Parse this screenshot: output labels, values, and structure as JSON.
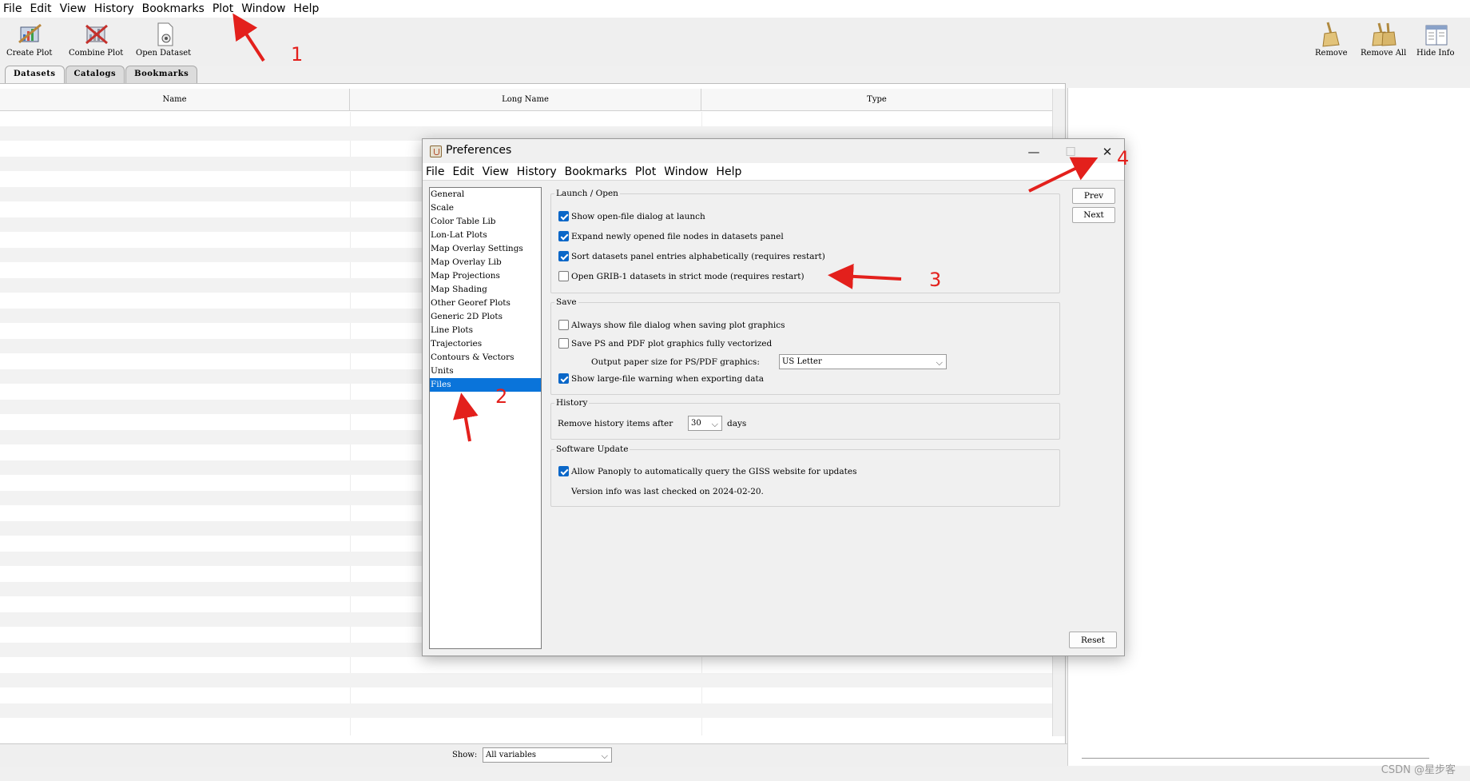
{
  "main_menu": [
    "File",
    "Edit",
    "View",
    "History",
    "Bookmarks",
    "Plot",
    "Window",
    "Help"
  ],
  "toolbar": {
    "create_plot": "Create Plot",
    "combine_plot": "Combine Plot",
    "open_dataset": "Open Dataset",
    "remove": "Remove",
    "remove_all": "Remove All",
    "hide_info": "Hide Info"
  },
  "tabs": [
    "Datasets",
    "Catalogs",
    "Bookmarks"
  ],
  "table": {
    "columns": [
      "Name",
      "Long Name",
      "Type"
    ]
  },
  "bottom": {
    "show_label": "Show:",
    "show_value": "All variables"
  },
  "watermark": "CSDN @星步客",
  "dialog": {
    "title": "Preferences",
    "menu": [
      "File",
      "Edit",
      "View",
      "History",
      "Bookmarks",
      "Plot",
      "Window",
      "Help"
    ],
    "categories": [
      "General",
      "Scale",
      "Color Table Lib",
      "Lon-Lat Plots",
      "Map Overlay Settings",
      "Map Overlay Lib",
      "Map Projections",
      "Map Shading",
      "Other Georef Plots",
      "Generic 2D Plots",
      "Line Plots",
      "Trajectories",
      "Contours & Vectors",
      "Units",
      "Files"
    ],
    "selected_category": "Files",
    "launch": {
      "title": "Launch / Open",
      "opt1": "Show open-file dialog at launch",
      "opt2": "Expand newly opened file nodes in datasets panel",
      "opt3": "Sort datasets panel entries alphabetically (requires restart)",
      "opt4": "Open GRIB-1 datasets in strict mode (requires restart)",
      "checked": [
        true,
        true,
        true,
        false
      ]
    },
    "save": {
      "title": "Save",
      "opt1": "Always show file dialog when saving plot graphics",
      "opt2": "Save PS and PDF plot graphics fully vectorized",
      "paper_label": "Output paper size for PS/PDF graphics:",
      "paper_value": "US Letter",
      "opt3": "Show large-file warning when exporting data",
      "checked": [
        false,
        false,
        true
      ]
    },
    "history": {
      "title": "History",
      "label": "Remove history items after",
      "value": "30",
      "unit": "days"
    },
    "update": {
      "title": "Software Update",
      "opt1": "Allow Panoply to automatically query the GISS website for updates",
      "info": "Version info was last checked on 2024-02-20.",
      "checked": [
        true
      ]
    },
    "buttons": {
      "prev": "Prev",
      "next": "Next",
      "reset": "Reset"
    }
  },
  "annotations": [
    "1",
    "2",
    "3",
    "4"
  ],
  "colors": {
    "selection": "#0a74da",
    "checkbox": "#0a67c8",
    "annotation": "#e3201c"
  },
  "icons": [
    "create-plot-icon",
    "combine-plot-icon",
    "open-dataset-icon",
    "remove-icon",
    "remove-all-icon",
    "hide-info-icon",
    "java-app-icon",
    "minimize-icon",
    "maximize-icon",
    "close-icon",
    "chevron-down-icon"
  ]
}
